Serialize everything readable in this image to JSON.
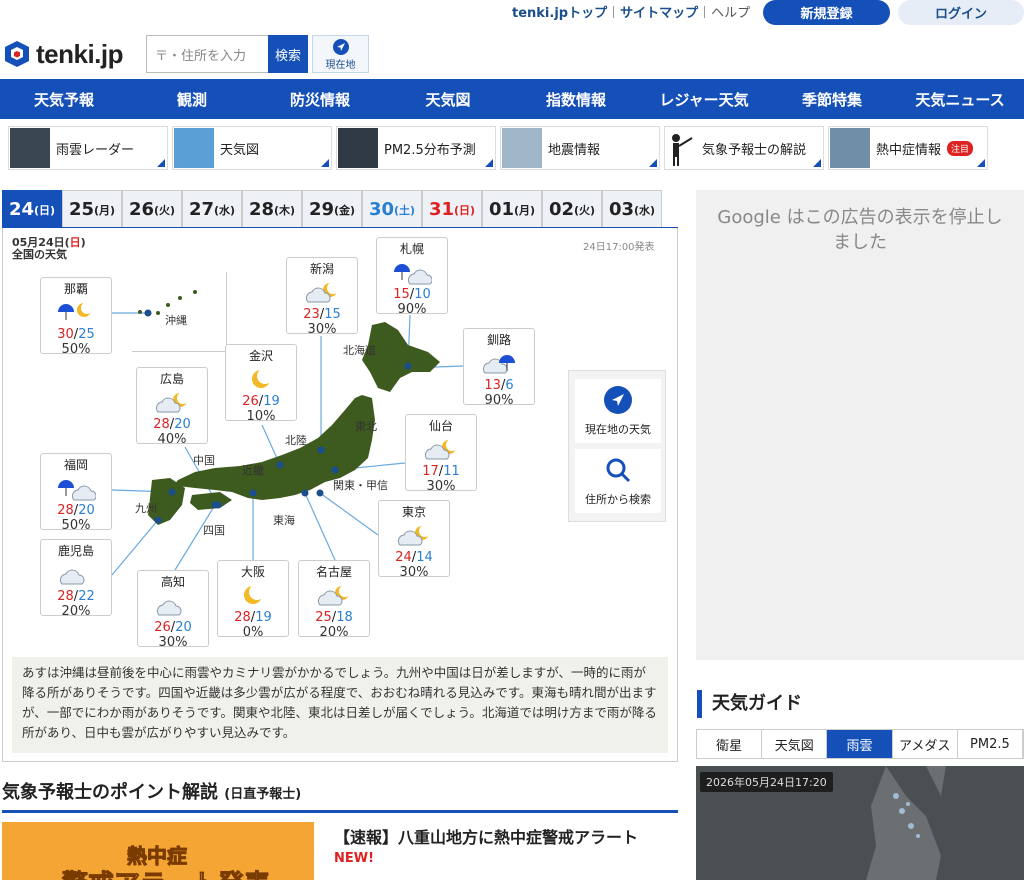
{
  "header": {
    "links": [
      "tenki.jpトップ",
      "サイトマップ",
      "ヘルプ"
    ],
    "register": "新規登録",
    "login": "ログイン",
    "logo": "tenki.jp",
    "search_placeholder": "〒・住所を入力",
    "search_button": "検索",
    "location_button": "現在地"
  },
  "nav": [
    "天気予報",
    "観測",
    "防災情報",
    "天気図",
    "指数情報",
    "レジャー天気",
    "季節特集",
    "天気ニュース"
  ],
  "subnav": [
    {
      "label": "雨雲レーダー"
    },
    {
      "label": "天気図"
    },
    {
      "label": "PM2.5分布予測"
    },
    {
      "label": "地震情報"
    },
    {
      "label": "気象予報士の解説"
    },
    {
      "label": "熱中症情報",
      "badge": "注目"
    }
  ],
  "date_tabs": [
    {
      "day": "24",
      "dow": "(日)",
      "kind": "active"
    },
    {
      "day": "25",
      "dow": "(月)",
      "kind": ""
    },
    {
      "day": "26",
      "dow": "(火)",
      "kind": ""
    },
    {
      "day": "27",
      "dow": "(水)",
      "kind": ""
    },
    {
      "day": "28",
      "dow": "(木)",
      "kind": ""
    },
    {
      "day": "29",
      "dow": "(金)",
      "kind": ""
    },
    {
      "day": "30",
      "dow": "(土)",
      "kind": "sat"
    },
    {
      "day": "31",
      "dow": "(日)",
      "kind": "sun"
    },
    {
      "day": "01",
      "dow": "(月)",
      "kind": ""
    },
    {
      "day": "02",
      "dow": "(火)",
      "kind": ""
    },
    {
      "day": "03",
      "dow": "(水)",
      "kind": ""
    }
  ],
  "map": {
    "date_prefix": "05月24日(",
    "date_dow": "日",
    "date_suffix": ")",
    "subtitle": "全国の天気",
    "issued": "24日17:00発表",
    "regions": [
      "沖縄",
      "北海道",
      "東北",
      "北陸",
      "中国",
      "近畿",
      "関東・甲信",
      "九州",
      "四国",
      "東海"
    ],
    "cities": [
      {
        "name": "那覇",
        "icon": "rain-moon",
        "hi": "30",
        "lo": "25",
        "pop": "50%"
      },
      {
        "name": "新潟",
        "icon": "cloud-moon",
        "hi": "23",
        "lo": "15",
        "pop": "30%"
      },
      {
        "name": "札幌",
        "icon": "rain-cloud",
        "hi": "15",
        "lo": "10",
        "pop": "90%"
      },
      {
        "name": "釧路",
        "icon": "cloud-rain",
        "hi": "13",
        "lo": "6",
        "pop": "90%"
      },
      {
        "name": "金沢",
        "icon": "moon",
        "hi": "26",
        "lo": "19",
        "pop": "10%"
      },
      {
        "name": "広島",
        "icon": "cloud-moon",
        "hi": "28",
        "lo": "20",
        "pop": "40%"
      },
      {
        "name": "仙台",
        "icon": "cloud-moon",
        "hi": "17",
        "lo": "11",
        "pop": "30%"
      },
      {
        "name": "福岡",
        "icon": "rain-cloud",
        "hi": "28",
        "lo": "20",
        "pop": "50%"
      },
      {
        "name": "東京",
        "icon": "cloud-moon",
        "hi": "24",
        "lo": "14",
        "pop": "30%"
      },
      {
        "name": "鹿児島",
        "icon": "cloud",
        "hi": "28",
        "lo": "22",
        "pop": "20%"
      },
      {
        "name": "高知",
        "icon": "cloud",
        "hi": "26",
        "lo": "20",
        "pop": "30%"
      },
      {
        "name": "大阪",
        "icon": "moon",
        "hi": "28",
        "lo": "19",
        "pop": "0%"
      },
      {
        "name": "名古屋",
        "icon": "cloud-moon",
        "hi": "25",
        "lo": "18",
        "pop": "20%"
      }
    ],
    "side_current": "現在地の天気",
    "side_search": "住所から検索",
    "description": "あすは沖縄は昼前後を中心に雨雲やカミナリ雲がかかるでしょう。九州や中国は日が差しますが、一時的に雨が降る所がありそうです。四国や近畿は多少雲が広がる程度で、おおむね晴れる見込みです。東海も晴れ間が出ますが、一部でにわか雨がありそうです。関東や北陸、東北は日差しが届くでしょう。北海道では明け方まで雨が降る所があり、日中も雲が広がりやすい見込みです。"
  },
  "ad": {
    "text": "Google はこの広告の表示を停止しました"
  },
  "guide": {
    "title": "天気ガイド",
    "tabs": [
      "衛星",
      "天気図",
      "雨雲",
      "アメダス",
      "PM2.5"
    ],
    "active_tab": 2,
    "timestamp": "2026年05月24日17:20"
  },
  "expert": {
    "heading": "気象予報士のポイント解説",
    "by": "(日直予報士)",
    "banner_line1": "熱中症",
    "banner_line2": "警戒アラート発表",
    "news_title": "【速報】八重山地方に熱中症警戒アラート",
    "new_label": "NEW!"
  },
  "colors": {
    "brand": "#1550b8",
    "hi_temp": "#dd2222",
    "lo_temp": "#2a7fd4",
    "saturday": "#2a7fd4",
    "sunday": "#dd2222"
  }
}
